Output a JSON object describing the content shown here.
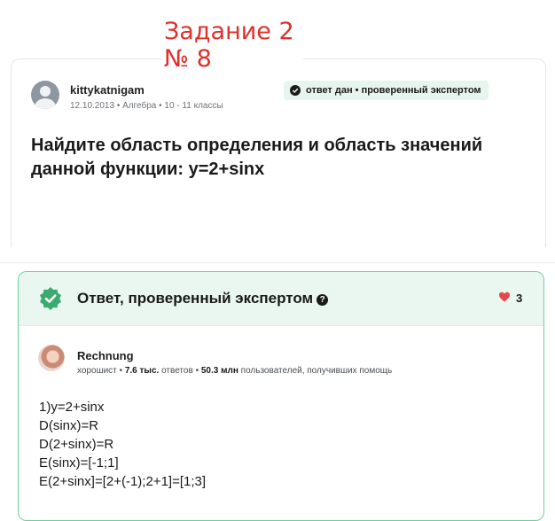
{
  "overlay": {
    "line1": "Задание 2",
    "line2": "№ 8"
  },
  "question": {
    "username": "kittykatnigam",
    "date": "12.10.2013",
    "subject": "Алгебра",
    "grade": "10 - 11 классы",
    "badge": "ответ дан • проверенный экспертом",
    "text": "Найдите область определения и область значений данной функции: y=2+sinx"
  },
  "answer": {
    "header_title": "Ответ, проверенный экспертом",
    "likes": "3",
    "username": "Rechnung",
    "rank": "хорошист",
    "answers_count": "7.6 тыс.",
    "answers_label": "ответов",
    "helped_count": "50.3 млн",
    "helped_label": "пользователей, получивших помощь",
    "lines": [
      "1)y=2+sinx",
      "D(sinx)=R",
      "D(2+sinx)=R",
      "E(sinx)=[-1;1]",
      "E(2+sinx]=[2+(-1);2+1]=[1;3]"
    ]
  },
  "colors": {
    "overlay_text": "#e0302a",
    "accent_green": "#3aaa6e",
    "heart": "#e5484d"
  },
  "icons": {
    "question_avatar": "default-user-avatar-icon",
    "badge": "check-circle-icon",
    "seal": "verified-seal-icon",
    "help": "question-circle-icon",
    "like": "heart-icon"
  }
}
